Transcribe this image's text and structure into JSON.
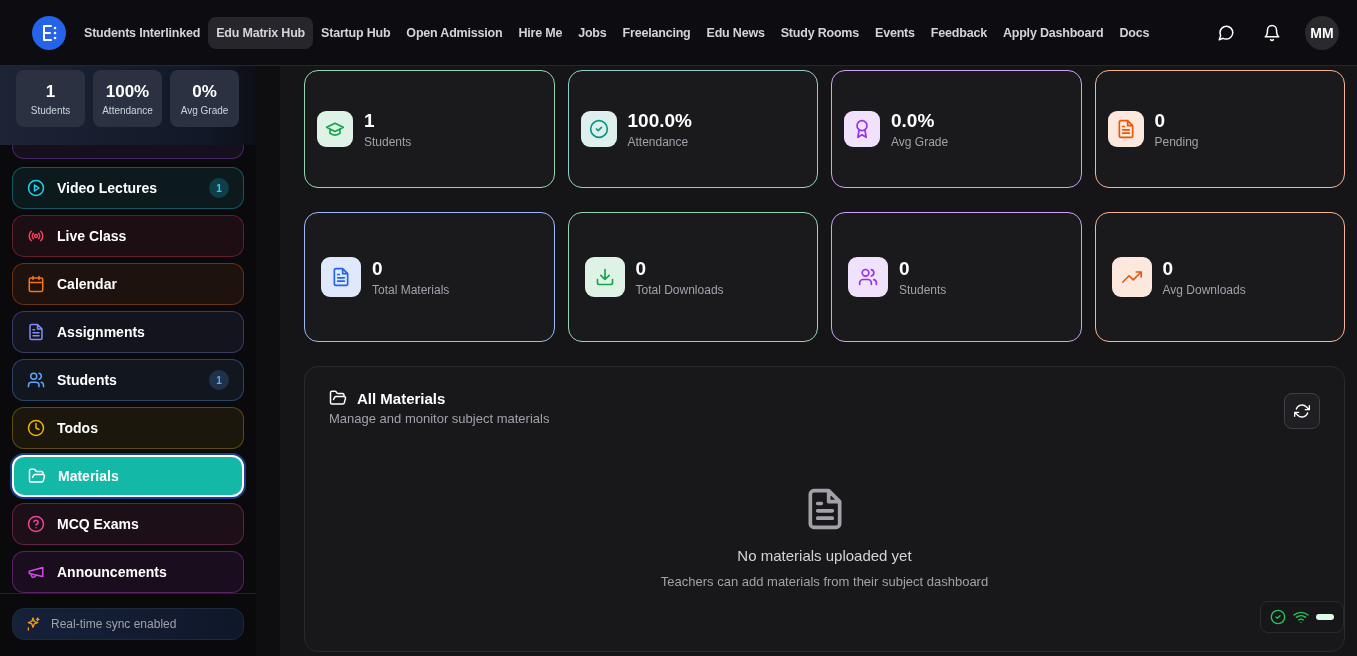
{
  "nav": {
    "links": [
      {
        "label": "Students Interlinked",
        "selected": false
      },
      {
        "label": "Edu Matrix Hub",
        "selected": true
      },
      {
        "label": "Startup Hub",
        "selected": false
      },
      {
        "label": "Open Admission",
        "selected": false
      },
      {
        "label": "Hire Me",
        "selected": false
      },
      {
        "label": "Jobs",
        "selected": false
      },
      {
        "label": "Freelancing",
        "selected": false
      },
      {
        "label": "Edu News",
        "selected": false
      },
      {
        "label": "Study Rooms",
        "selected": false
      },
      {
        "label": "Events",
        "selected": false
      },
      {
        "label": "Feedback",
        "selected": false
      },
      {
        "label": "Apply Dashboard",
        "selected": false
      },
      {
        "label": "Docs",
        "selected": false
      }
    ],
    "avatar": "MM"
  },
  "sidebar": {
    "summary": [
      {
        "value": "1",
        "label": "Students"
      },
      {
        "value": "100%",
        "label": "Attendance"
      },
      {
        "value": "0%",
        "label": "Avg Grade"
      }
    ],
    "items": [
      {
        "label": "Video Lectures",
        "color": "#22d3ee",
        "badge": "1",
        "selected": false
      },
      {
        "label": "Live Class",
        "color": "#f43f5e",
        "selected": false
      },
      {
        "label": "Calendar",
        "color": "#f97316",
        "selected": false
      },
      {
        "label": "Assignments",
        "color": "#818cf8",
        "selected": false
      },
      {
        "label": "Students",
        "color": "#60a5fa",
        "badge": "1",
        "selected": false
      },
      {
        "label": "Todos",
        "color": "#eab308",
        "selected": false
      },
      {
        "label": "Materials",
        "color": "#14b8a6",
        "selected": true
      },
      {
        "label": "MCQ Exams",
        "color": "#ec4899",
        "selected": false
      },
      {
        "label": "Announcements",
        "color": "#d946ef",
        "selected": false
      }
    ],
    "sync": "Real-time sync enabled"
  },
  "stats": [
    [
      {
        "value": "1",
        "label": "Students",
        "color": "#16a34a"
      },
      {
        "value": "100.0%",
        "label": "Attendance",
        "color": "#0d9488"
      },
      {
        "value": "0.0%",
        "label": "Avg Grade",
        "color": "#9333ea"
      },
      {
        "value": "0",
        "label": "Pending",
        "color": "#ea580c"
      }
    ],
    [
      {
        "value": "0",
        "label": "Total Materials",
        "color": "#2563eb"
      },
      {
        "value": "0",
        "label": "Total Downloads",
        "color": "#16a34a"
      },
      {
        "value": "0",
        "label": "Students",
        "color": "#9333ea"
      },
      {
        "value": "0",
        "label": "Avg Downloads",
        "color": "#ea580c"
      }
    ]
  ],
  "materials": {
    "title": "All Materials",
    "subtitle": "Manage and monitor subject materials",
    "empty_title": "No materials uploaded yet",
    "empty_text": "Teachers can add materials from their subject dashboard"
  }
}
